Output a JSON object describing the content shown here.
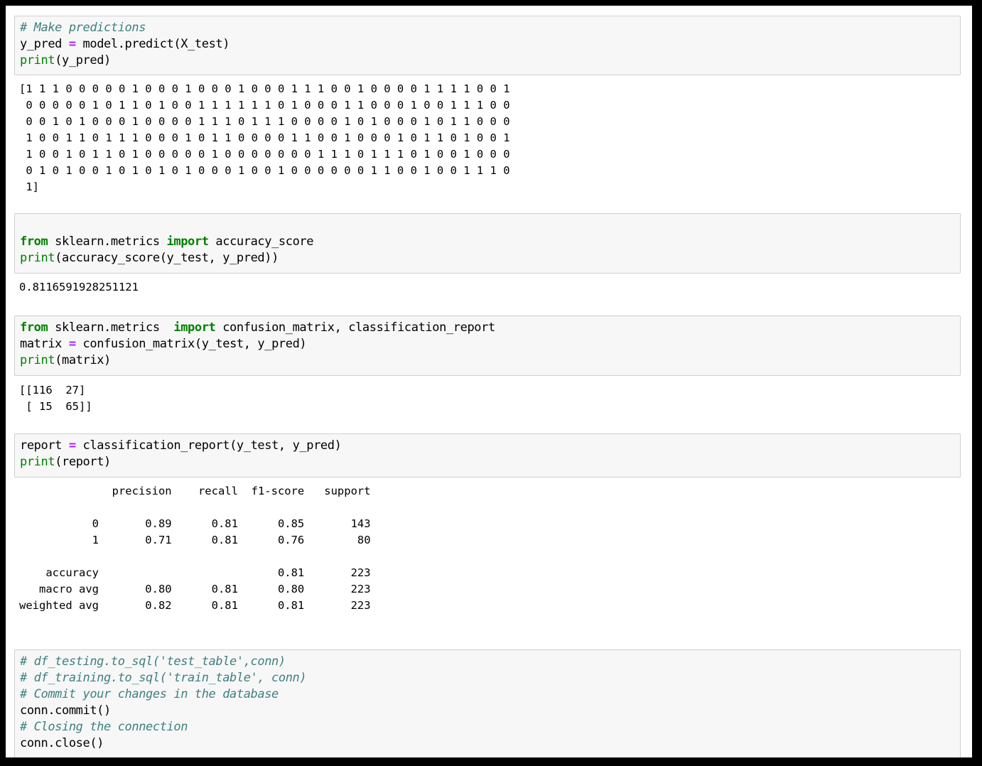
{
  "cells": [
    {
      "code_lines": [
        {
          "comment": "# Make predictions"
        },
        {
          "plain1": "y_pred ",
          "op": "=",
          "plain2": " model.predict(X_test)"
        },
        {
          "builtin": "print",
          "plain1": "(y_pred)"
        }
      ],
      "output_lines": [
        "[1 1 1 0 0 0 0 0 1 0 0 0 1 0 0 0 1 0 0 0 1 1 1 0 0 1 0 0 0 0 1 1 1 1 0 0 1",
        " 0 0 0 0 0 1 0 1 1 0 1 0 0 1 1 1 1 1 1 0 1 0 0 0 1 1 0 0 0 1 0 0 1 1 1 0 0",
        " 0 0 1 0 1 0 0 0 1 0 0 0 0 1 1 1 0 1 1 1 0 0 0 0 1 0 1 0 0 0 1 0 1 1 0 0 0",
        " 1 0 0 1 1 0 1 1 1 0 0 0 1 0 1 1 0 0 0 0 1 1 0 0 1 0 0 0 1 0 1 1 0 1 0 0 1",
        " 1 0 0 1 0 1 1 0 1 0 0 0 0 0 1 0 0 0 0 0 0 0 1 1 1 0 1 1 1 0 1 0 0 1 0 0 0",
        " 0 1 0 1 0 0 1 0 1 0 1 0 1 0 0 0 1 0 0 1 0 0 0 0 0 0 1 1 0 0 1 0 0 1 1 1 0",
        " 1]"
      ]
    },
    {
      "code_lines": [
        {
          "plain1": ""
        },
        {
          "kw1": "from",
          "plain1": " sklearn.metrics ",
          "kw2": "import",
          "plain2": " accuracy_score"
        },
        {
          "builtin": "print",
          "plain1": "(accuracy_score(y_test, y_pred))"
        }
      ],
      "output_lines": [
        "0.8116591928251121"
      ]
    },
    {
      "code_lines": [
        {
          "kw1": "from",
          "plain1": " sklearn.metrics  ",
          "kw2": "import",
          "plain2": " confusion_matrix, classification_report"
        },
        {
          "plain1": "matrix ",
          "op": "=",
          "plain2": " confusion_matrix(y_test, y_pred)"
        },
        {
          "builtin": "print",
          "plain1": "(matrix)"
        }
      ],
      "output_lines": [
        "[[116  27]",
        " [ 15  65]]"
      ]
    },
    {
      "code_lines": [
        {
          "plain1": "report ",
          "op": "=",
          "plain2": " classification_report(y_test, y_pred)"
        },
        {
          "builtin": "print",
          "plain1": "(report)"
        }
      ],
      "output_lines": [
        "              precision    recall  f1-score   support",
        "",
        "           0       0.89      0.81      0.85       143",
        "           1       0.71      0.81      0.76        80",
        "",
        "    accuracy                           0.81       223",
        "   macro avg       0.80      0.81      0.80       223",
        "weighted avg       0.82      0.81      0.81       223"
      ]
    },
    {
      "code_lines": [
        {
          "comment": "# df_testing.to_sql('test_table',conn)"
        },
        {
          "comment": "# df_training.to_sql('train_table', conn)"
        },
        {
          "comment": "# Commit your changes in the database"
        },
        {
          "plain1": "conn.commit()"
        },
        {
          "comment": "# Closing the connection"
        },
        {
          "plain1": "conn.close()"
        }
      ],
      "output_lines": []
    }
  ]
}
